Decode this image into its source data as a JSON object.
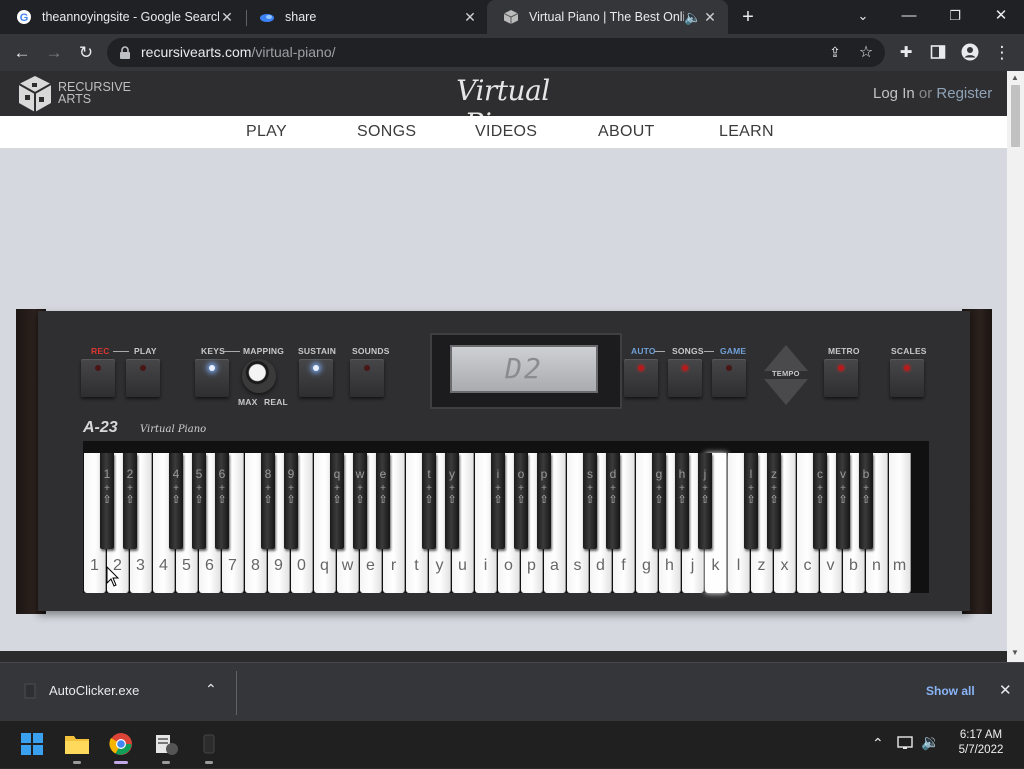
{
  "browser": {
    "tabs": [
      {
        "title": "theannoyingsite - Google Search",
        "icon": "google-icon"
      },
      {
        "title": "share",
        "icon": "share-app-icon"
      },
      {
        "title": "Virtual Piano | The Best Onlin",
        "icon": "recursive-arts-icon",
        "active": true
      }
    ],
    "new_tab": "+",
    "url_domain": "recursivearts.com",
    "url_path": "/virtual-piano/"
  },
  "site": {
    "brand_line1": "RECURSIVE",
    "brand_line2": "ARTS",
    "logo_text": "Virtual Piano",
    "login": "Log In",
    "or": "or",
    "register": "Register",
    "nav": [
      "PLAY",
      "SONGS",
      "VIDEOS",
      "ABOUT",
      "LEARN"
    ]
  },
  "piano": {
    "labels": {
      "rec": "REC",
      "play": "PLAY",
      "keys": "KEYS",
      "mapping": "MAPPING",
      "sustain": "SUSTAIN",
      "sounds": "SOUNDS",
      "max": "MAX",
      "real": "REAL",
      "auto": "AUTO",
      "songs": "SONGS",
      "game": "GAME",
      "tempo": "TEMPO",
      "metro": "METRO",
      "scales": "SCALES"
    },
    "display": "D2",
    "model": "A-23",
    "model_sub": "Virtual Piano",
    "white_keys": [
      "1",
      "2",
      "3",
      "4",
      "5",
      "6",
      "7",
      "8",
      "9",
      "0",
      "q",
      "w",
      "e",
      "r",
      "t",
      "y",
      "u",
      "i",
      "o",
      "p",
      "a",
      "s",
      "d",
      "f",
      "g",
      "h",
      "j",
      "k",
      "l",
      "z",
      "x",
      "c",
      "v",
      "b",
      "n",
      "m"
    ],
    "black_keys": [
      "1",
      "2",
      "4",
      "5",
      "6",
      "8",
      "9",
      "q",
      "w",
      "e",
      "t",
      "y",
      "i",
      "o",
      "p",
      "s",
      "d",
      "g",
      "h",
      "j",
      "l",
      "z",
      "c",
      "v",
      "b"
    ],
    "pressed_white_index": 27
  },
  "download": {
    "file": "AutoClicker.exe",
    "show_all": "Show all"
  },
  "taskbar": {
    "time": "6:17 AM",
    "date": "5/7/2022"
  }
}
